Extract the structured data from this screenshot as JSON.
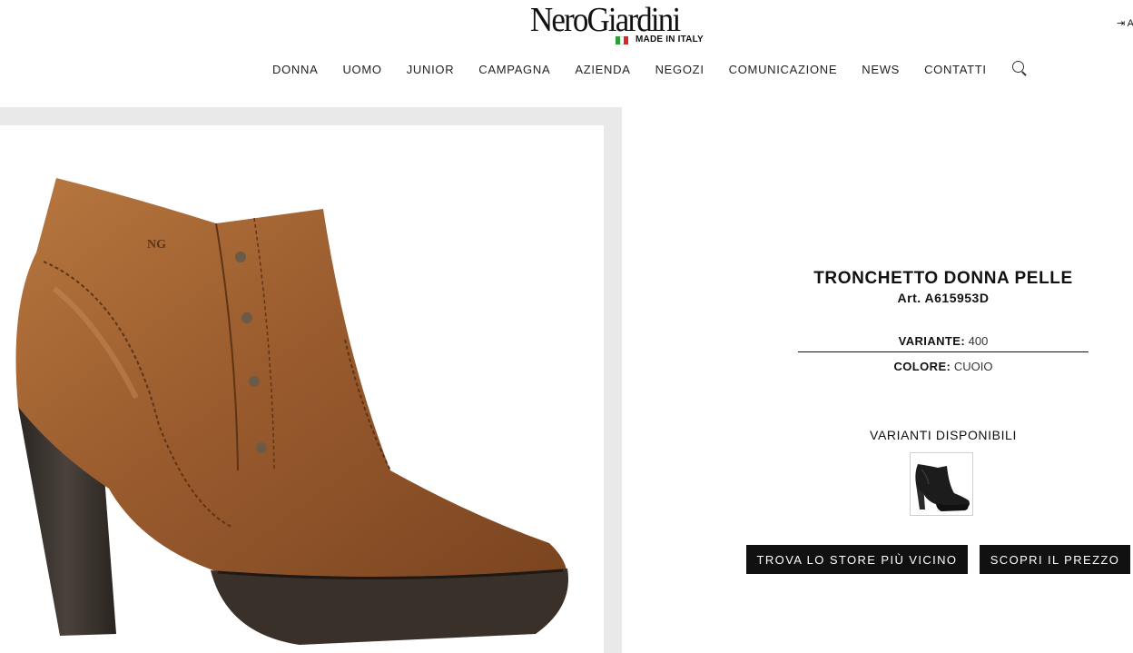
{
  "header": {
    "logo_text": "NeroGiardini",
    "logo_tagline": "MADE IN ITALY",
    "flag_colors": [
      "#2e9e3a",
      "#ffffff",
      "#d42a2a"
    ],
    "account_icon": "sign-in-icon",
    "account_text": "A"
  },
  "nav": {
    "items": [
      "DONNA",
      "UOMO",
      "JUNIOR",
      "CAMPAGNA",
      "AZIENDA",
      "NEGOZI",
      "COMUNICAZIONE",
      "NEWS",
      "CONTATTI"
    ],
    "search_icon": "search-icon"
  },
  "product": {
    "title": "TRONCHETTO DONNA PELLE",
    "article": "Art. A615953D",
    "variante_label": "VARIANTE",
    "variante_value": "400",
    "colore_label": "COLORE",
    "colore_value": "CUOIO",
    "main_image": "brown-leather-heeled-ankle-boot",
    "main_color": "#9a5c2e"
  },
  "variants": {
    "label": "VARIANTI DISPONIBILI",
    "items": [
      {
        "image": "black-leather-heeled-ankle-boot",
        "color": "#1a1a1a"
      }
    ]
  },
  "actions": {
    "store_button": "TROVA LO STORE PIÙ VICINO",
    "price_button": "SCOPRI IL PREZZO"
  },
  "colors": {
    "frame_bg": "#e9e9e9",
    "button_bg": "#111111",
    "button_text": "#ffffff"
  }
}
